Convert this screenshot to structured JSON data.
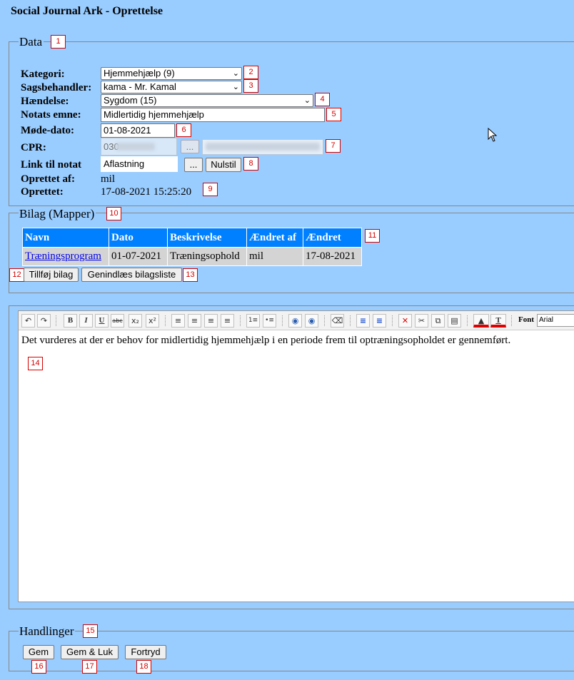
{
  "page_title": "Social Journal Ark - Oprettelse",
  "data_section": {
    "legend": "Data",
    "kategori_label": "Kategori:",
    "kategori_value": "Hjemmehjælp (9)",
    "sagsbehandler_label": "Sagsbehandler:",
    "sagsbehandler_value": "kama - Mr. Kamal",
    "haendelse_label": "Hændelse:",
    "haendelse_value": "Sygdom (15)",
    "emne_label": "Notats emne:",
    "emne_value": "Midlertidig hjemmehjælp",
    "modedato_label": "Møde-dato:",
    "modedato_value": "01-08-2021",
    "cpr_label": "CPR:",
    "cpr_value": "030",
    "cpr_lookup_button": "...",
    "link_label": "Link til notat",
    "link_value": "Aflastning",
    "link_browse_button": "...",
    "nulstil_button": "Nulstil",
    "oprettet_af_label": "Oprettet af:",
    "oprettet_af_value": "mil",
    "oprettet_label": "Oprettet:",
    "oprettet_value": "17-08-2021 15:25:20"
  },
  "bilag_section": {
    "legend": "Bilag (Mapper)",
    "columns": [
      "Navn",
      "Dato",
      "Beskrivelse",
      "Ændret af",
      "Ændret"
    ],
    "rows": [
      {
        "navn": "Træningsprogram",
        "dato": "01-07-2021",
        "beskrivelse": "Træningsophold",
        "aendret_af": "mil",
        "aendret": "17-08-2021"
      }
    ],
    "add_button": "Tillføj bilag",
    "reload_button": "Genindlæs bilagsliste"
  },
  "editor": {
    "font_label": "Font",
    "font_value": "Arial",
    "content": "Det vurderes at  der er behov for midlertidig hjemmehjælp i en periode frem til optræningsopholdet er gennemført.",
    "toolbar_icons": [
      "undo-icon",
      "redo-icon",
      "bold-icon",
      "italic-icon",
      "underline-icon",
      "strikethrough-icon",
      "subscript-icon",
      "superscript-icon",
      "align-left-icon",
      "align-center-icon",
      "align-right-icon",
      "justify-icon",
      "numbered-list-icon",
      "bullet-list-icon",
      "find-icon",
      "replace-icon",
      "eraser-icon",
      "paragraph-icon",
      "remove-format-icon",
      "delete-icon",
      "cut-icon",
      "copy-icon",
      "paste-icon",
      "background-color-icon",
      "text-color-icon"
    ]
  },
  "handlinger_section": {
    "legend": "Handlinger",
    "gem_button": "Gem",
    "gem_luk_button": "Gem & Luk",
    "fortryd_button": "Fortryd"
  },
  "badges": [
    "1",
    "2",
    "3",
    "4",
    "5",
    "6",
    "7",
    "8",
    "9",
    "10",
    "11",
    "12",
    "13",
    "14",
    "15",
    "16",
    "17",
    "18"
  ],
  "colors": {
    "background": "#99ccff",
    "table_header": "#0080ff",
    "table_cell": "#d4d4d4",
    "badge_border": "#d40000"
  }
}
